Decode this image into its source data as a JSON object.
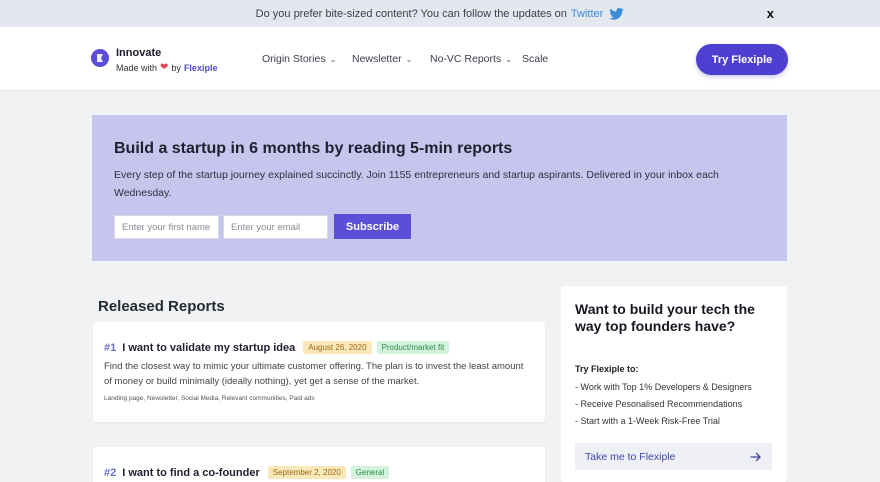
{
  "announcement": {
    "text": "Do you prefer bite-sized content? You can follow the updates on",
    "link": "Twitter",
    "close": "x"
  },
  "brand": {
    "name": "Innovate",
    "made_with": "Made with",
    "by": "by",
    "partner": "Flexiple"
  },
  "nav": {
    "items": [
      {
        "label": "Origin Stories",
        "dropdown": true
      },
      {
        "label": "Newsletter",
        "dropdown": true
      },
      {
        "label": "No-VC Reports",
        "dropdown": true
      },
      {
        "label": "Scale",
        "dropdown": false
      }
    ],
    "cta": "Try Flexiple"
  },
  "hero": {
    "title": "Build a startup in 6 months by reading 5-min reports",
    "subtitle": "Every step of the startup journey explained succinctly. Join 1155 entrepreneurs and startup aspirants. Delivered in your inbox each Wednesday.",
    "first_name_placeholder": "Enter your first name",
    "email_placeholder": "Enter your email",
    "subscribe": "Subscribe"
  },
  "reports": {
    "heading": "Released Reports",
    "items": [
      {
        "number": "#1",
        "title": "I want to validate my startup idea",
        "date": "August 26, 2020",
        "category": "Product/market fit",
        "description": "Find the closest way to mimic your ultimate customer offering. The plan is to invest the least amount of money or build minimally (ideally nothing), yet get a sense of the market.",
        "keywords": "Landing page, Newsletter, Social Media, Relevant communities, Paid ads"
      },
      {
        "number": "#2",
        "title": "I want to find a co-founder",
        "date": "September 2, 2020",
        "category": "General"
      }
    ]
  },
  "sidebar": {
    "heading": "Want to build your tech the way top founders have?",
    "label": "Try Flexiple to:",
    "benefits": [
      "- Work with Top 1% Developers & Designers",
      "- Receive Pesonalised Recommendations",
      "- Start with a 1-Week Risk-Free Trial"
    ],
    "cta": "Take me to Flexiple"
  },
  "colors": {
    "accent": "#4f3fd0",
    "hero_bg": "#c5c5ee",
    "twitter": "#3b8ddb"
  }
}
